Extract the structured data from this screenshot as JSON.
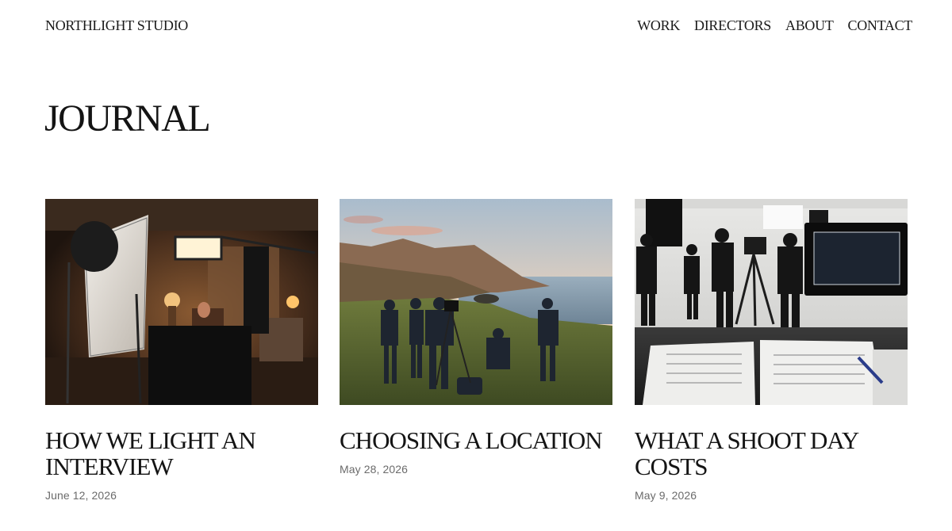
{
  "site": {
    "brand": "NORTHLIGHT STUDIO"
  },
  "nav": {
    "items": [
      {
        "label": "WORK"
      },
      {
        "label": "DIRECTORS"
      },
      {
        "label": "ABOUT"
      },
      {
        "label": "CONTACT"
      }
    ]
  },
  "page": {
    "title": "JOURNAL"
  },
  "posts": [
    {
      "title": "HOW WE LIGHT AN INTERVIEW",
      "date": "June 12, 2026",
      "image": "interview-lighting-setup-photo"
    },
    {
      "title": "CHOOSING A LOCATION",
      "date": "May 28, 2026",
      "image": "coastal-location-scout-photo"
    },
    {
      "title": "WHAT A SHOOT DAY COSTS",
      "date": "May 9, 2026",
      "image": "studio-shoot-day-photo"
    }
  ]
}
